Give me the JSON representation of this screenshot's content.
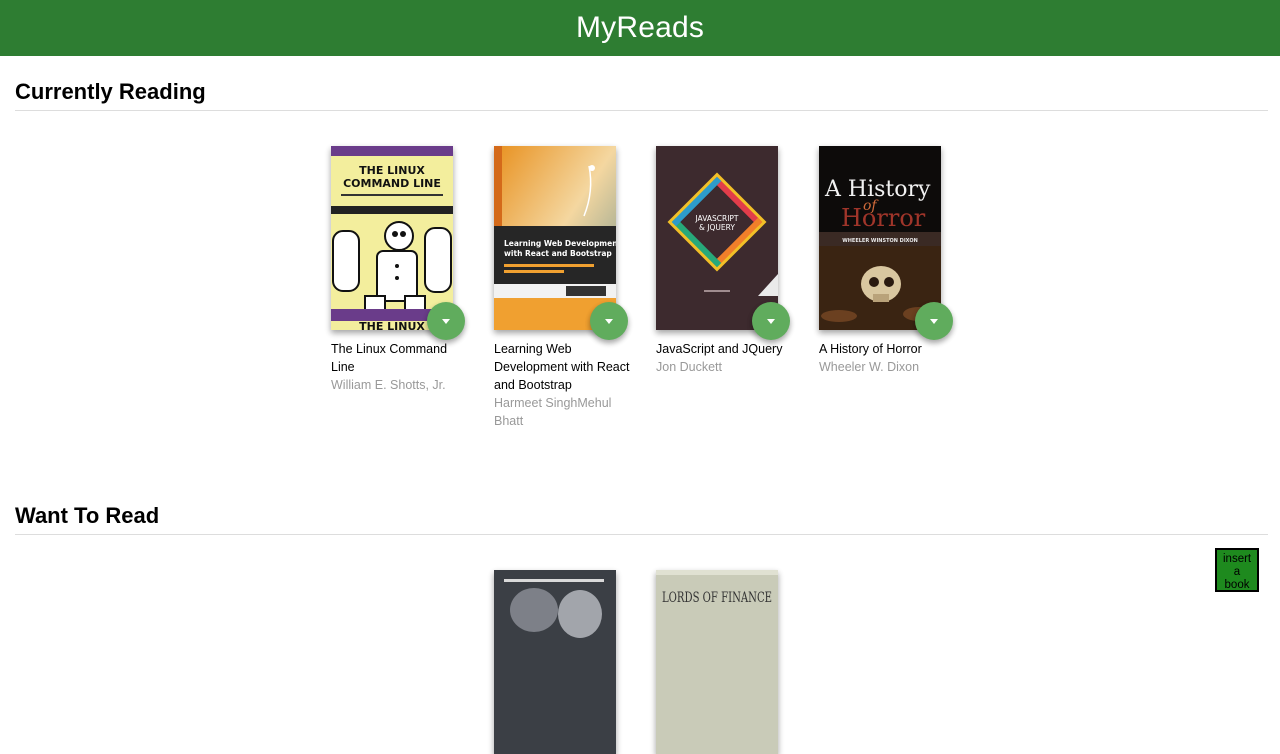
{
  "header": {
    "title": "MyReads"
  },
  "shelves": [
    {
      "title": "Currently Reading",
      "books": [
        {
          "title": "The Linux Command Line",
          "authors": "William E. Shotts, Jr.",
          "cover_text": [
            "THE LINUX",
            "COMMAND LINE"
          ]
        },
        {
          "title": "Learning Web Development with React and Bootstrap",
          "authors": "Harmeet SinghMehul Bhatt",
          "cover_text": [
            "Learning Web Development",
            "with React and Bootstrap"
          ]
        },
        {
          "title": "JavaScript and JQuery",
          "authors": "Jon Duckett",
          "cover_text": [
            "JAVASCRIPT",
            "& JQUERY"
          ]
        },
        {
          "title": "A History of Horror",
          "authors": "Wheeler W. Dixon",
          "cover_text": [
            "A History",
            "of",
            "Horror",
            "WHEELER WINSTON DIXON"
          ]
        }
      ]
    },
    {
      "title": "Want To Read",
      "books": [
        {
          "title": "",
          "authors": "",
          "cover_text": []
        },
        {
          "title": "",
          "authors": "",
          "cover_text": [
            "LORDS OF FINANCE"
          ]
        }
      ]
    }
  ],
  "add_button": {
    "label": "insert a book"
  },
  "colors": {
    "header": "#2e7d32",
    "changer": "#60ac5d",
    "author_text": "#999999"
  },
  "icons": {
    "changer": "triangle-down-icon"
  }
}
